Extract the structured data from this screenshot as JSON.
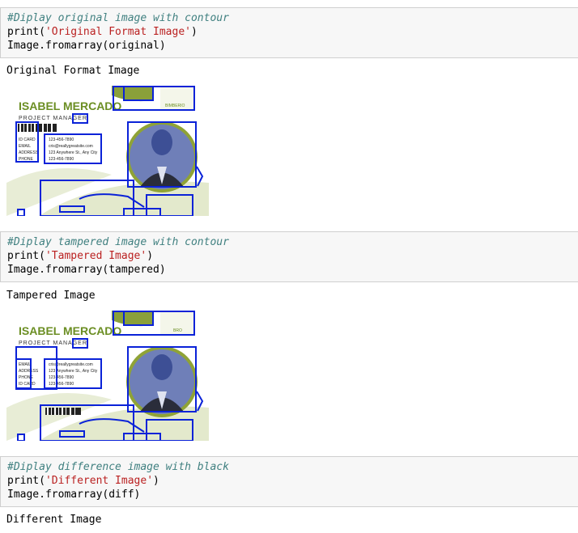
{
  "cells": [
    {
      "comment": "#Diplay original image with contour",
      "print_fn": "print(",
      "print_str": "'Original Format Image'",
      "print_close": ")",
      "code2": "Image.fromarray(original)",
      "output": "Original Format Image"
    },
    {
      "comment": "#Diplay tampered image with contour",
      "print_fn": "print(",
      "print_str": "'Tampered Image'",
      "print_close": ")",
      "code2": "Image.fromarray(tampered)",
      "output": "Tampered Image"
    },
    {
      "comment": "#Diplay difference image with black",
      "print_fn": "print(",
      "print_str": "'Different Image'",
      "print_close": ")",
      "code2": "Image.fromarray(diff)",
      "output": "Different Image"
    }
  ],
  "id_card_original": {
    "name": "ISABEL MERCADO",
    "role": "PROJECT MANAGER",
    "rows": [
      {
        "label": "ID CARD",
        "value": "123-456-7890"
      },
      {
        "label": "EMAIL",
        "value": "cris@reallygreatsite.com"
      },
      {
        "label": "ADDRESS",
        "value": "123 Anywhere St., Any City"
      },
      {
        "label": "PHONE",
        "value": "123-456-7890"
      }
    ],
    "brand": "BIMBERIO"
  },
  "id_card_tampered": {
    "name": "ISABEL MERCADO",
    "role": "PROJECT MANAGER",
    "rows": [
      {
        "label": "EMAIL",
        "value": "cris@reallygreatsite.com"
      },
      {
        "label": "ADDRESS",
        "value": "123 Anywhere St., Any City"
      },
      {
        "label": "PHONE",
        "value": "123-456-7890"
      },
      {
        "label": "ID CARD",
        "value": "123-456-7890"
      }
    ],
    "brand": "BRO"
  },
  "colors": {
    "comment": "#408080",
    "string": "#ba2121",
    "contour": "#0a22d8",
    "brand_green": "#6b8e23",
    "cell_bg": "#f7f7f7"
  }
}
